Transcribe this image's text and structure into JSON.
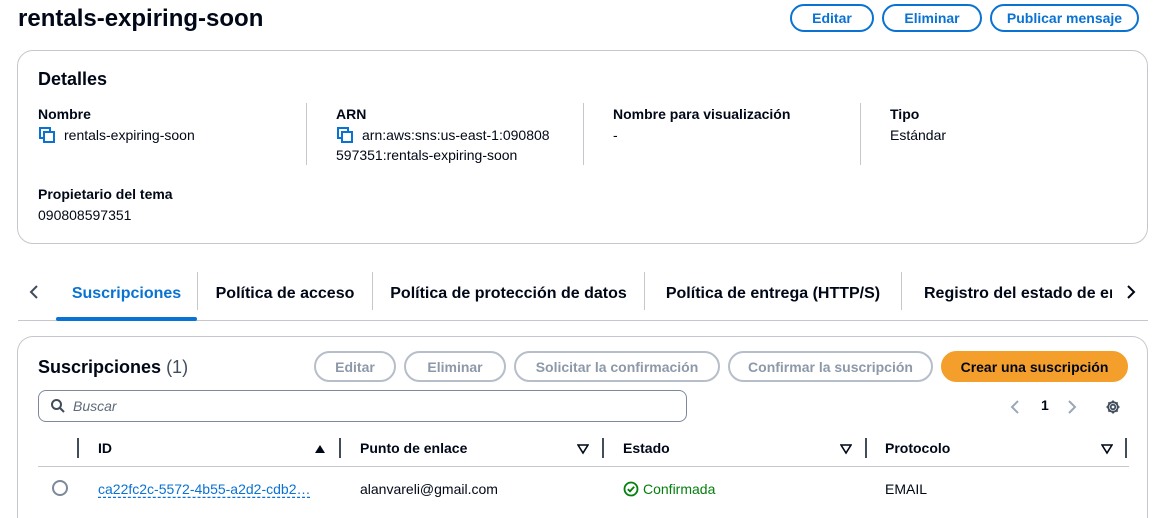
{
  "header": {
    "title": "rentals-expiring-soon",
    "edit_label": "Editar",
    "delete_label": "Eliminar",
    "publish_label": "Publicar mensaje"
  },
  "details": {
    "title": "Detalles",
    "name_label": "Nombre",
    "name_value": "rentals-expiring-soon",
    "arn_label": "ARN",
    "arn_value_line1": "arn:aws:sns:us-east-1:090808",
    "arn_value_line2": "597351:rentals-expiring-soon",
    "display_name_label": "Nombre para visualización",
    "display_name_value": "-",
    "type_label": "Tipo",
    "type_value": "Estándar",
    "owner_label": "Propietario del tema",
    "owner_value": "090808597351"
  },
  "tabs": [
    {
      "label": "Suscripciones",
      "active": true
    },
    {
      "label": "Política de acceso"
    },
    {
      "label": "Política de protección de datos"
    },
    {
      "label": "Política de entrega (HTTP/S)"
    },
    {
      "label": "Registro del estado de entrega"
    }
  ],
  "subscriptions": {
    "title": "Suscripciones",
    "count": "(1)",
    "edit_label": "Editar",
    "delete_label": "Eliminar",
    "request_confirm_label": "Solicitar la confirmación",
    "confirm_label": "Confirmar la suscripción",
    "create_label": "Crear una suscripción",
    "search_placeholder": "Buscar",
    "page": "1",
    "columns": {
      "id": "ID",
      "endpoint": "Punto de enlace",
      "status": "Estado",
      "protocol": "Protocolo"
    },
    "rows": [
      {
        "id": "ca22fc2c-5572-4b55-a2d2-cdb2…",
        "endpoint": "alanvareli@gmail.com",
        "status": "Confirmada",
        "protocol": "EMAIL"
      }
    ]
  },
  "colors": {
    "accent": "#0972d3",
    "primary_button": "#f49e2c",
    "success": "#037f0c"
  }
}
